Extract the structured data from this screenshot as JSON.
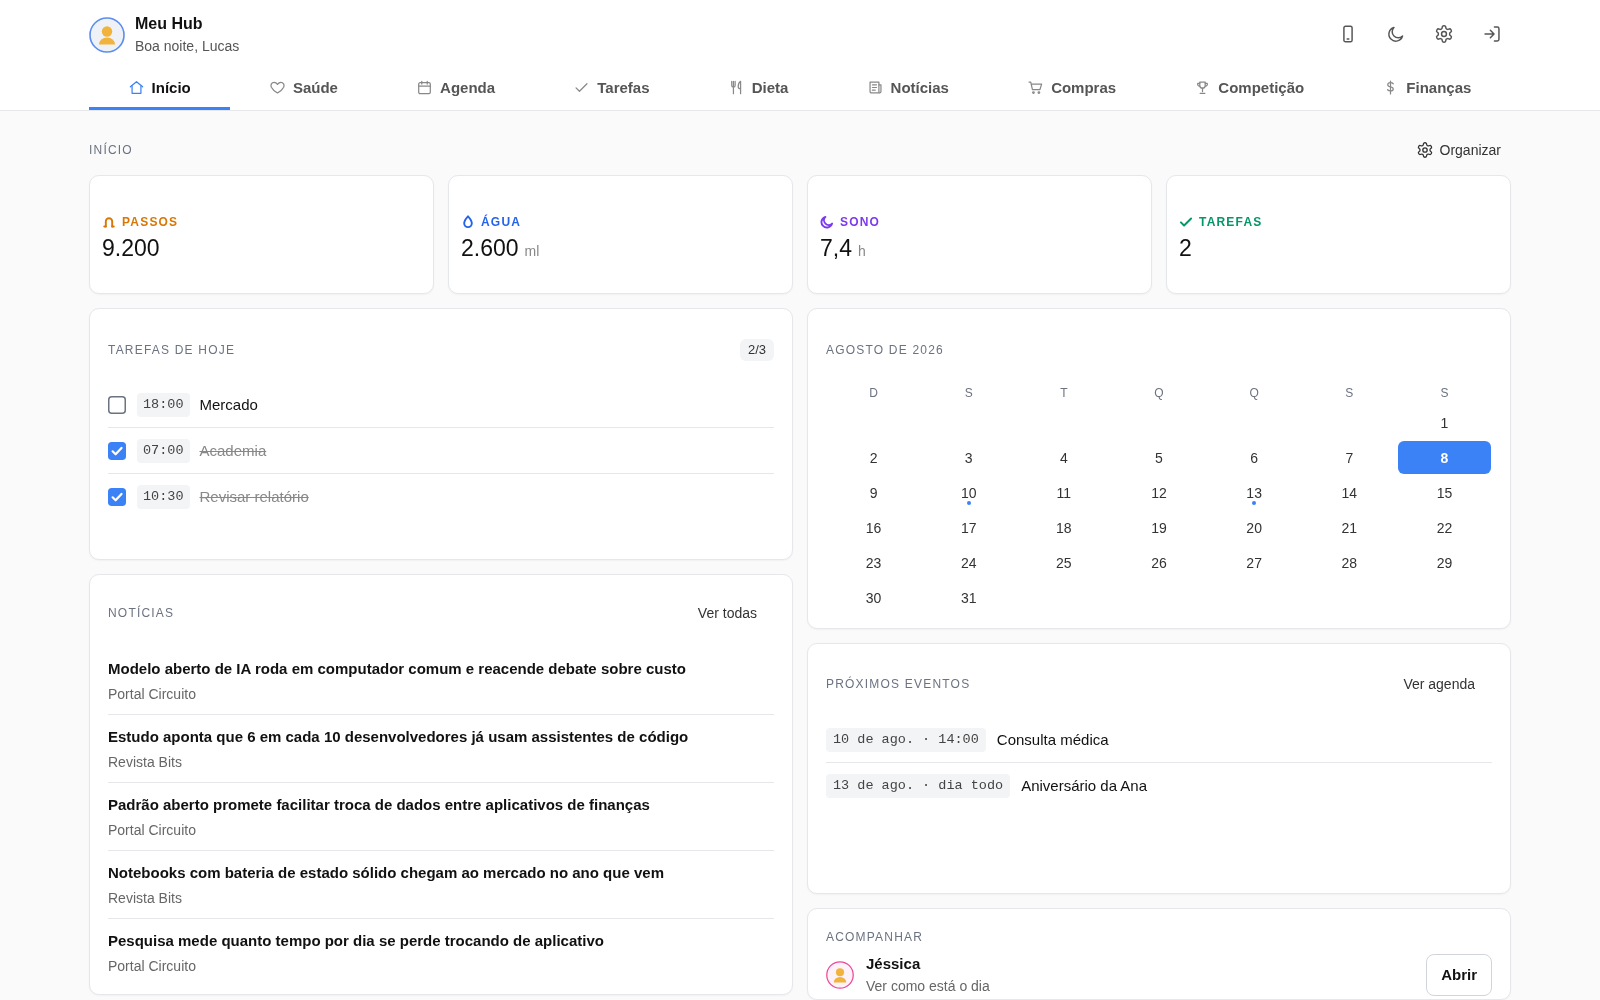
{
  "header": {
    "title": "Meu Hub",
    "subtitle": "Boa noite, Lucas"
  },
  "tabs": [
    {
      "label": "Início",
      "selected": true
    },
    {
      "label": "Saúde",
      "selected": false
    },
    {
      "label": "Agenda",
      "selected": false
    },
    {
      "label": "Tarefas",
      "selected": false
    },
    {
      "label": "Dieta",
      "selected": false
    },
    {
      "label": "Notícias",
      "selected": false
    },
    {
      "label": "Compras",
      "selected": false
    },
    {
      "label": "Competição",
      "selected": false
    },
    {
      "label": "Finanças",
      "selected": false
    }
  ],
  "section": {
    "title": "INÍCIO",
    "action": "Organizar"
  },
  "stats": [
    {
      "label": "PASSOS",
      "value": "9.200",
      "color": "#d97706"
    },
    {
      "label": "ÁGUA",
      "value": "2.600",
      "unit": "ml",
      "color": "#2563eb"
    },
    {
      "label": "SONO",
      "value": "7,4",
      "unit": "h",
      "color": "#7c3aed"
    },
    {
      "label": "TAREFAS",
      "value": "2",
      "color": "#059669"
    }
  ],
  "tasks": {
    "title": "TAREFAS DE HOJE",
    "count": "2/3",
    "items": [
      {
        "time": "18:00",
        "label": "Mercado",
        "checked": false
      },
      {
        "time": "07:00",
        "label": "Academia",
        "checked": true
      },
      {
        "time": "10:30",
        "label": "Revisar relatório",
        "checked": true
      }
    ]
  },
  "calendar": {
    "title": "AGOSTO DE 2026",
    "weekdays": [
      "D",
      "S",
      "T",
      "Q",
      "Q",
      "S",
      "S"
    ],
    "weeks": [
      [
        {
          "label": "1",
          "selected": false,
          "event": false
        }
      ],
      [
        {
          "label": "2",
          "selected": false,
          "event": false
        },
        {
          "label": "3",
          "selected": false,
          "event": false
        },
        {
          "label": "4",
          "selected": false,
          "event": false
        },
        {
          "label": "5",
          "selected": false,
          "event": false
        },
        {
          "label": "6",
          "selected": false,
          "event": false
        },
        {
          "label": "7",
          "selected": false,
          "event": false
        },
        {
          "label": "8",
          "selected": true,
          "event": false
        }
      ],
      [
        {
          "label": "9",
          "selected": false,
          "event": false
        },
        {
          "label": "10",
          "selected": false,
          "event": true
        },
        {
          "label": "11",
          "selected": false,
          "event": false
        },
        {
          "label": "12",
          "selected": false,
          "event": false
        },
        {
          "label": "13",
          "selected": false,
          "event": true
        },
        {
          "label": "14",
          "selected": false,
          "event": false
        },
        {
          "label": "15",
          "selected": false,
          "event": false
        }
      ],
      [
        {
          "label": "16",
          "selected": false,
          "event": false
        },
        {
          "label": "17",
          "selected": false,
          "event": false
        },
        {
          "label": "18",
          "selected": false,
          "event": false
        },
        {
          "label": "19",
          "selected": false,
          "event": false
        },
        {
          "label": "20",
          "selected": false,
          "event": false
        },
        {
          "label": "21",
          "selected": false,
          "event": false
        },
        {
          "label": "22",
          "selected": false,
          "event": false
        }
      ],
      [
        {
          "label": "23",
          "selected": false,
          "event": false
        },
        {
          "label": "24",
          "selected": false,
          "event": false
        },
        {
          "label": "25",
          "selected": false,
          "event": false
        },
        {
          "label": "26",
          "selected": false,
          "event": false
        },
        {
          "label": "27",
          "selected": false,
          "event": false
        },
        {
          "label": "28",
          "selected": false,
          "event": false
        },
        {
          "label": "29",
          "selected": false,
          "event": false
        }
      ],
      [
        {
          "label": "30",
          "selected": false,
          "event": false
        },
        {
          "label": "31",
          "selected": false,
          "event": false
        }
      ]
    ]
  },
  "news": {
    "title": "NOTÍCIAS",
    "action": "Ver todas",
    "items": [
      {
        "headline": "Modelo aberto de IA roda em computador comum e reacende debate sobre custo",
        "source": "Portal Circuito"
      },
      {
        "headline": "Estudo aponta que 6 em cada 10 desenvolvedores já usam assistentes de código",
        "source": "Revista Bits"
      },
      {
        "headline": "Padrão aberto promete facilitar troca de dados entre aplicativos de finanças",
        "source": "Portal Circuito"
      },
      {
        "headline": "Notebooks com bateria de estado sólido chegam ao mercado no ano que vem",
        "source": "Revista Bits"
      },
      {
        "headline": "Pesquisa mede quanto tempo por dia se perde trocando de aplicativo",
        "source": "Portal Circuito"
      }
    ]
  },
  "events": {
    "title": "PRÓXIMOS EVENTOS",
    "action": "Ver agenda",
    "items": [
      {
        "when": "10 de ago. · 14:00",
        "title": "Consulta médica"
      },
      {
        "when": "13 de ago. · dia todo",
        "title": "Aniversário da Ana"
      }
    ]
  },
  "follow": {
    "title": "ACOMPANHAR",
    "people": [
      {
        "name": "Jéssica",
        "subtitle": "Ver como está o dia",
        "action": "Abrir"
      }
    ]
  }
}
